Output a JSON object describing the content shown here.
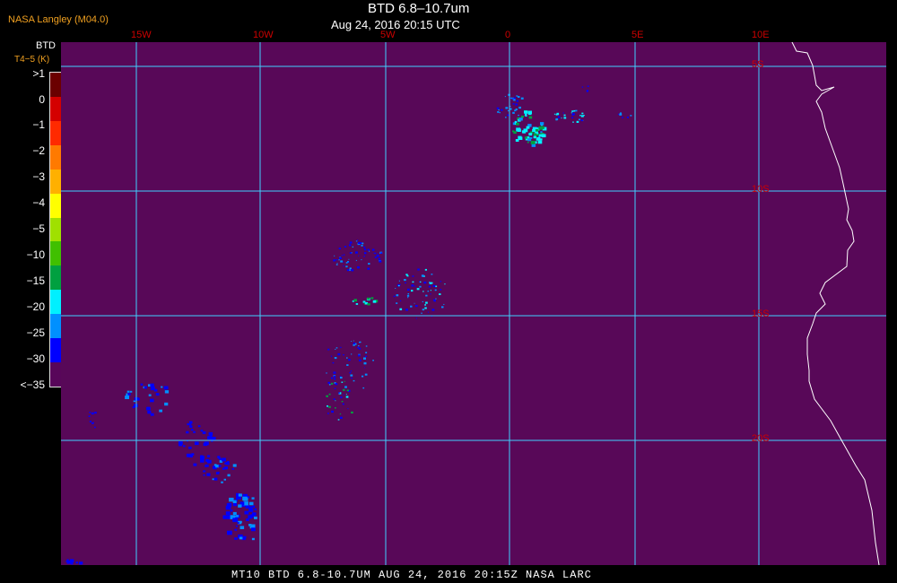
{
  "header": {
    "org": "NASA Langley (M04.0)",
    "title": "BTD 6.8–10.7um",
    "subtitle": "Aug 24, 2016 20:15 UTC"
  },
  "legend": {
    "title": "BTD",
    "units": "T4−5 (K)",
    "labels": [
      ">1",
      "0",
      "−1",
      "−2",
      "−3",
      "−4",
      "−5",
      "−10",
      "−15",
      "−20",
      "−25",
      "−30",
      "<−35"
    ],
    "colors": [
      "#6b0000",
      "#d40000",
      "#ff2a00",
      "#ff7a00",
      "#ffb000",
      "#ffff00",
      "#a0e000",
      "#40c000",
      "#00a040",
      "#00f0ff",
      "#0090ff",
      "#0000ff",
      "#58065a"
    ]
  },
  "map": {
    "background_color": "#580858",
    "grid_color": "#40d0ff",
    "coast_color": "#ffffff",
    "lon_labels": [
      "15W",
      "10W",
      "5W",
      "0",
      "5E",
      "10E"
    ],
    "lat_labels": [
      "5S",
      "10S",
      "15S",
      "20S"
    ]
  },
  "footer": {
    "text": "MT10  BTD 6.8-10.7UM  AUG 24, 2016 20:15Z  NASA LARC"
  }
}
